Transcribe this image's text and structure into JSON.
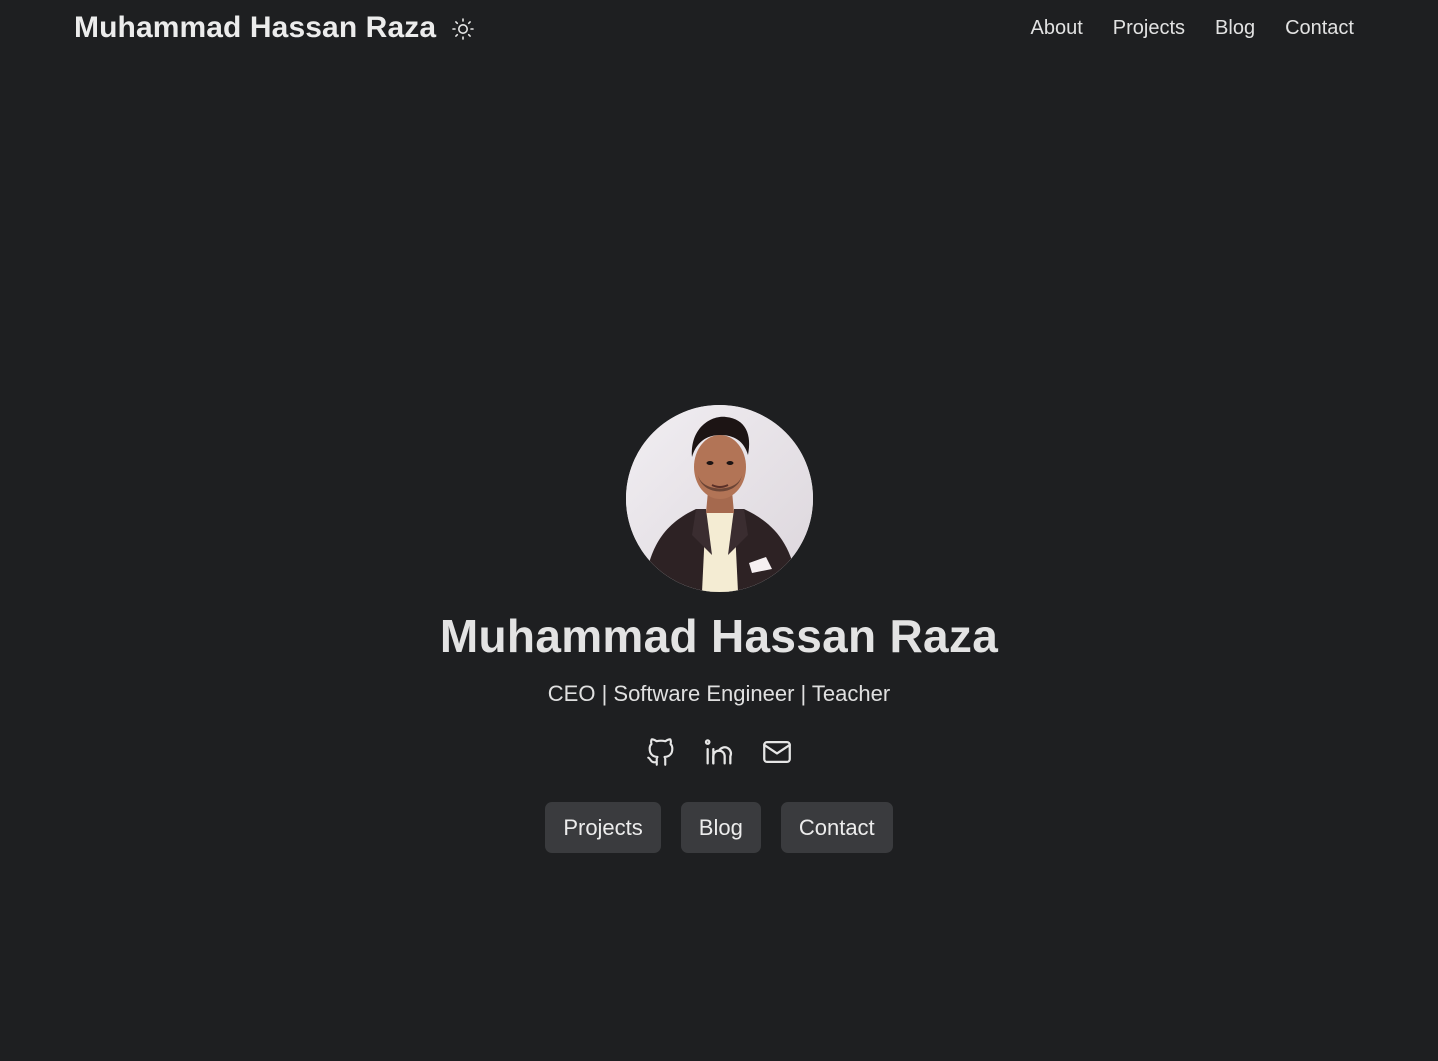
{
  "header": {
    "brand": "Muhammad Hassan Raza",
    "theme_icon": "sun-icon",
    "nav": [
      {
        "label": "About"
      },
      {
        "label": "Projects"
      },
      {
        "label": "Blog"
      },
      {
        "label": "Contact"
      }
    ]
  },
  "hero": {
    "avatar_alt": "Muhammad Hassan Raza",
    "name": "Muhammad Hassan Raza",
    "tagline": "CEO | Software Engineer | Teacher",
    "socials": [
      {
        "icon": "github-icon"
      },
      {
        "icon": "linkedin-icon"
      },
      {
        "icon": "mail-icon"
      }
    ],
    "buttons": [
      {
        "label": "Projects"
      },
      {
        "label": "Blog"
      },
      {
        "label": "Contact"
      }
    ]
  },
  "colors": {
    "background": "#1e1f21",
    "button_bg": "#3a3b3e",
    "text": "#e6e6e6"
  }
}
